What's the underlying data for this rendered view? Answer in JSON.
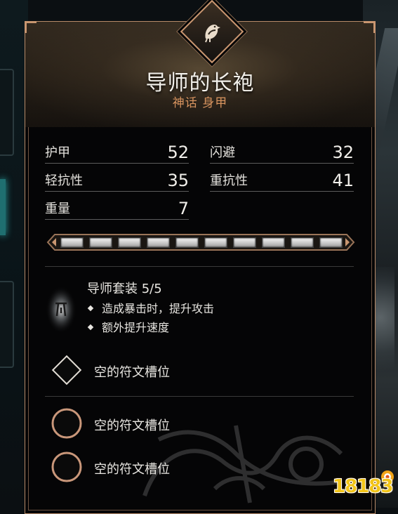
{
  "item": {
    "name": "导师的长袍",
    "rarity": "神话",
    "slot_type": "身甲",
    "accent_color": "#d8945f"
  },
  "stats": [
    {
      "label": "护甲",
      "value": "52"
    },
    {
      "label": "闪避",
      "value": "32"
    },
    {
      "label": "轻抗性",
      "value": "35"
    },
    {
      "label": "重抗性",
      "value": "41"
    },
    {
      "label": "重量",
      "value": "7"
    }
  ],
  "upgrade": {
    "filled": 10,
    "total": 10
  },
  "set_bonus": {
    "icon": "set-glyph-icon",
    "title": "导师套装 5/5",
    "effects": [
      "造成暴击时，提升攻击",
      "额外提升速度"
    ]
  },
  "runes": [
    {
      "shape": "diamond-slot-icon",
      "label": "空的符文槽位"
    },
    {
      "shape": "circle-slot-icon",
      "label": "空的符文槽位"
    },
    {
      "shape": "circle-slot-icon",
      "label": "空的符文槽位"
    }
  ],
  "watermark": {
    "text": "18183"
  }
}
